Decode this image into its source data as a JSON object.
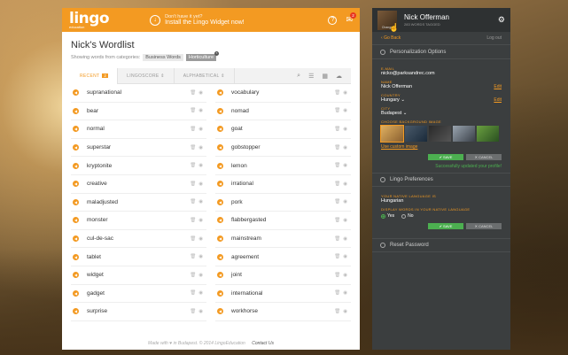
{
  "header": {
    "logo": "lingo",
    "logo_sub": "education",
    "download_small": "Don't have it yet?",
    "download_big": "Install the Lingo Widget now!",
    "help": "?",
    "mail_count": "2"
  },
  "wordlist": {
    "title": "Nick's Wordlist",
    "categories_label": "Showing words from categories:",
    "categories": [
      "Business Words",
      "Horticulture"
    ],
    "tabs": {
      "recent": "RECENT",
      "recent_badge": "2",
      "lingoscore": "LINGOSCORE",
      "alphabetical": "ALPHABETICAL"
    },
    "words_left": [
      "supranational",
      "bear",
      "normal",
      "superstar",
      "kryptonite",
      "creative",
      "maladjusted",
      "monster",
      "cul-de-sac",
      "tablet",
      "widget",
      "gadget",
      "surprise"
    ],
    "words_right": [
      "vocabulary",
      "nomad",
      "goat",
      "gobstopper",
      "lemon",
      "irrational",
      "pork",
      "flabbergasted",
      "mainstream",
      "agreement",
      "joint",
      "international",
      "workhorse"
    ]
  },
  "footer": {
    "text": "Made with ♥ in Budapest.  © 2014 LingoEducation",
    "contact": "Contact Us"
  },
  "panel": {
    "avatar_label": "Change",
    "name": "Nick Offerman",
    "sub": "283 WORDS TAGGED",
    "go_back": "Go Back",
    "logout": "Log out",
    "personalization": "Personalization Options",
    "email_label": "E-MAIL",
    "email": "nicko@parksandrec.com",
    "name_label": "NAME",
    "country_label": "COUNTRY",
    "country": "Hungary",
    "city_label": "CITY",
    "city": "Budapest",
    "edit": "Edit",
    "bg_label": "CHOOSE BACKGROUND IMAGE",
    "custom_image": "Use custom image",
    "save": "SAVE",
    "cancel": "CANCEL",
    "success": "Successfully updated your profile!",
    "lingo_prefs": "Lingo Preferences",
    "native_label": "YOUR NATIVE LANGUAGE IS",
    "native": "Hungarian",
    "display_label": "DISPLAY WORDS IN YOUR NATIVE LANGUAGE",
    "yes": "Yes",
    "no": "No",
    "reset": "Reset Password"
  },
  "colors": {
    "accent": "#f39a22",
    "panel": "#3b3e3f",
    "success": "#4caf50"
  }
}
